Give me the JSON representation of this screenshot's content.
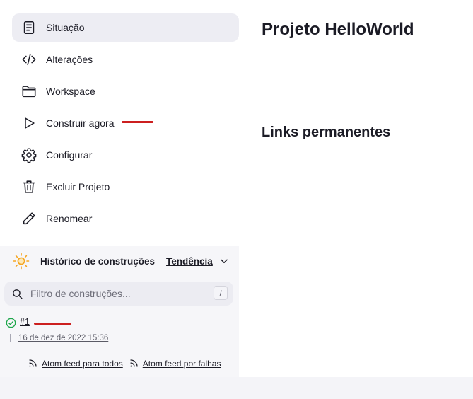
{
  "sidebar": {
    "tasks": [
      {
        "label": "Situação",
        "icon": "document-icon"
      },
      {
        "label": "Alterações",
        "icon": "code-icon"
      },
      {
        "label": "Workspace",
        "icon": "folder-icon"
      },
      {
        "label": "Construir agora",
        "icon": "play-icon"
      },
      {
        "label": "Configurar",
        "icon": "gear-icon"
      },
      {
        "label": "Excluir Projeto",
        "icon": "trash-icon"
      },
      {
        "label": "Renomear",
        "icon": "pencil-icon"
      }
    ]
  },
  "build_history": {
    "title": "Histórico de construções",
    "trend_label": "Tendência",
    "filter_placeholder": "Filtro de construções...",
    "shortcut_key": "/",
    "builds": [
      {
        "number": "#1",
        "date": "16 de dez de 2022 15:36",
        "status": "success"
      }
    ],
    "feeds": {
      "all": "Atom feed para todos",
      "failures": "Atom feed por falhas"
    }
  },
  "main": {
    "title": "Projeto HelloWorld",
    "permalinks_title": "Links permanentes"
  },
  "colors": {
    "accent_active_bg": "#ededf3",
    "success": "#1ea64b",
    "annotation_red": "#cc1f1f",
    "sun": "#f5a623"
  }
}
